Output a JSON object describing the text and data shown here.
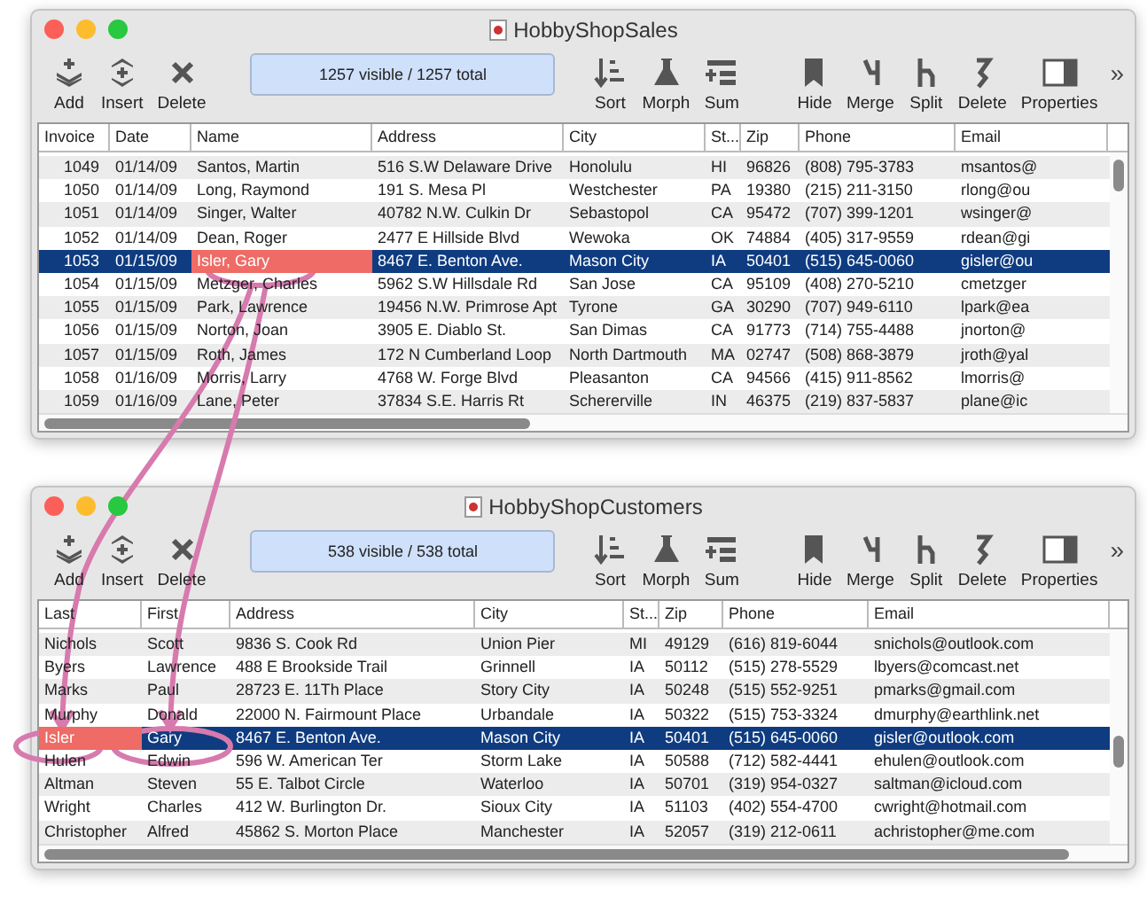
{
  "windows": [
    {
      "title": "HobbyShopSales",
      "toolbar": {
        "left": [
          {
            "label": "Add"
          },
          {
            "label": "Insert"
          },
          {
            "label": "Delete"
          }
        ],
        "counter": "1257 visible / 1257 total",
        "middle": [
          {
            "label": "Sort"
          },
          {
            "label": "Morph"
          },
          {
            "label": "Sum"
          }
        ],
        "right": [
          {
            "label": "Hide"
          },
          {
            "label": "Merge"
          },
          {
            "label": "Split"
          },
          {
            "label": "Delete"
          },
          {
            "label": "Properties"
          }
        ],
        "overflow": "»"
      },
      "table": {
        "columns": [
          {
            "label": "Invoice",
            "highlighted": false,
            "kind": "number"
          },
          {
            "label": "Date",
            "highlighted": false,
            "kind": "text"
          },
          {
            "label": "Name",
            "highlighted": true,
            "kind": "text"
          },
          {
            "label": "Address",
            "highlighted": false,
            "kind": "text"
          },
          {
            "label": "City",
            "highlighted": false,
            "kind": "text"
          },
          {
            "label": "St...",
            "highlighted": false,
            "kind": "text"
          },
          {
            "label": "Zip",
            "highlighted": false,
            "kind": "text"
          },
          {
            "label": "Phone",
            "highlighted": false,
            "kind": "text"
          },
          {
            "label": "Email",
            "highlighted": false,
            "kind": "text"
          }
        ],
        "rows": [
          {
            "selected": false,
            "cells": [
              "1049",
              "01/14/09",
              "Santos, Martin",
              "516 S.W Delaware Drive",
              "Honolulu",
              "HI",
              "96826",
              "(808) 795-3783",
              "msantos@"
            ]
          },
          {
            "selected": false,
            "cells": [
              "1050",
              "01/14/09",
              "Long, Raymond",
              "191 S. Mesa Pl",
              "Westchester",
              "PA",
              "19380",
              "(215) 211-3150",
              "rlong@ou"
            ]
          },
          {
            "selected": false,
            "cells": [
              "1051",
              "01/14/09",
              "Singer, Walter",
              "40782 N.W. Culkin Dr",
              "Sebastopol",
              "CA",
              "95472",
              "(707) 399-1201",
              "wsinger@"
            ]
          },
          {
            "selected": false,
            "cells": [
              "1052",
              "01/14/09",
              "Dean, Roger",
              "2477 E Hillside Blvd",
              "Wewoka",
              "OK",
              "74884",
              "(405) 317-9559",
              "rdean@gi"
            ]
          },
          {
            "selected": true,
            "cells": [
              "1053",
              "01/15/09",
              "Isler, Gary",
              "8467 E. Benton Ave.",
              "Mason City",
              "IA",
              "50401",
              "(515) 645-0060",
              "gisler@ou"
            ]
          },
          {
            "selected": false,
            "cells": [
              "1054",
              "01/15/09",
              "Metzger, Charles",
              "5962 S.W Hillsdale Rd",
              "San Jose",
              "CA",
              "95109",
              "(408) 270-5210",
              "cmetzger"
            ]
          },
          {
            "selected": false,
            "cells": [
              "1055",
              "01/15/09",
              "Park, Lawrence",
              "19456 N.W. Primrose Apt",
              "Tyrone",
              "GA",
              "30290",
              "(707) 949-6110",
              "lpark@ea"
            ]
          },
          {
            "selected": false,
            "cells": [
              "1056",
              "01/15/09",
              "Norton, Joan",
              "3905 E. Diablo St.",
              "San Dimas",
              "CA",
              "91773",
              "(714) 755-4488",
              "jnorton@"
            ]
          },
          {
            "selected": false,
            "cells": [
              "1057",
              "01/15/09",
              "Roth, James",
              "172 N Cumberland Loop",
              "North Dartmouth",
              "MA",
              "02747",
              "(508) 868-3879",
              "jroth@yal"
            ]
          },
          {
            "selected": false,
            "cells": [
              "1058",
              "01/16/09",
              "Morris, Larry",
              "4768 W. Forge Blvd",
              "Pleasanton",
              "CA",
              "94566",
              "(415) 911-8562",
              "lmorris@"
            ]
          },
          {
            "selected": false,
            "cells": [
              "1059",
              "01/16/09",
              "Lane, Peter",
              "37834 S.E. Harris Rt",
              "Schererville",
              "IN",
              "46375",
              "(219) 837-5837",
              "plane@ic"
            ]
          }
        ]
      }
    },
    {
      "title": "HobbyShopCustomers",
      "toolbar": {
        "left": [
          {
            "label": "Add"
          },
          {
            "label": "Insert"
          },
          {
            "label": "Delete"
          }
        ],
        "counter": "538 visible / 538 total",
        "middle": [
          {
            "label": "Sort"
          },
          {
            "label": "Morph"
          },
          {
            "label": "Sum"
          }
        ],
        "right": [
          {
            "label": "Hide"
          },
          {
            "label": "Merge"
          },
          {
            "label": "Split"
          },
          {
            "label": "Delete"
          },
          {
            "label": "Properties"
          }
        ],
        "overflow": "»"
      },
      "table": {
        "columns": [
          {
            "label": "Last",
            "highlighted": true,
            "kind": "text"
          },
          {
            "label": "First",
            "highlighted": false,
            "kind": "text"
          },
          {
            "label": "Address",
            "highlighted": false,
            "kind": "text"
          },
          {
            "label": "City",
            "highlighted": false,
            "kind": "text"
          },
          {
            "label": "St...",
            "highlighted": false,
            "kind": "text"
          },
          {
            "label": "Zip",
            "highlighted": false,
            "kind": "text"
          },
          {
            "label": "Phone",
            "highlighted": false,
            "kind": "text"
          },
          {
            "label": "Email",
            "highlighted": false,
            "kind": "text"
          }
        ],
        "rows": [
          {
            "selected": false,
            "cells": [
              "Nichols",
              "Scott",
              "9836 S. Cook Rd",
              "Union Pier",
              "MI",
              "49129",
              "(616) 819-6044",
              "snichols@outlook.com"
            ]
          },
          {
            "selected": false,
            "cells": [
              "Byers",
              "Lawrence",
              "488 E Brookside Trail",
              "Grinnell",
              "IA",
              "50112",
              "(515) 278-5529",
              "lbyers@comcast.net"
            ]
          },
          {
            "selected": false,
            "cells": [
              "Marks",
              "Paul",
              "28723 E. 11Th Place",
              "Story City",
              "IA",
              "50248",
              "(515) 552-9251",
              "pmarks@gmail.com"
            ]
          },
          {
            "selected": false,
            "cells": [
              "Murphy",
              "Donald",
              "22000 N. Fairmount Place",
              "Urbandale",
              "IA",
              "50322",
              "(515) 753-3324",
              "dmurphy@earthlink.net"
            ]
          },
          {
            "selected": true,
            "cells": [
              "Isler",
              "Gary",
              "8467 E. Benton Ave.",
              "Mason City",
              "IA",
              "50401",
              "(515) 645-0060",
              "gisler@outlook.com"
            ]
          },
          {
            "selected": false,
            "cells": [
              "Hulen",
              "Edwin",
              "596 W. American Ter",
              "Storm Lake",
              "IA",
              "50588",
              "(712) 582-4441",
              "ehulen@outlook.com"
            ]
          },
          {
            "selected": false,
            "cells": [
              "Altman",
              "Steven",
              "55 E. Talbot Circle",
              "Waterloo",
              "IA",
              "50701",
              "(319) 954-0327",
              "saltman@icloud.com"
            ]
          },
          {
            "selected": false,
            "cells": [
              "Wright",
              "Charles",
              "412 W. Burlington Dr.",
              "Sioux City",
              "IA",
              "51103",
              "(402) 554-4700",
              "cwright@hotmail.com"
            ]
          },
          {
            "selected": false,
            "cells": [
              "Christopher",
              "Alfred",
              "45862 S. Morton Place",
              "Manchester",
              "IA",
              "52057",
              "(319) 212-0611",
              "achristopher@me.com"
            ]
          }
        ]
      }
    }
  ]
}
